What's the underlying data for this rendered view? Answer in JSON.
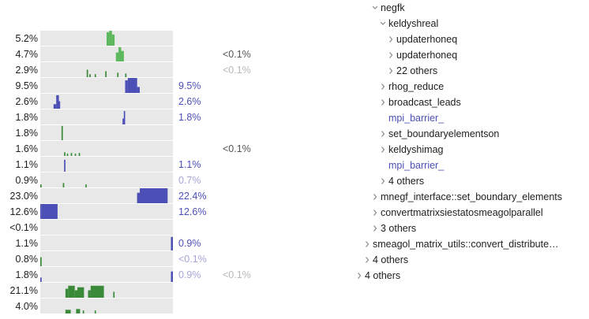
{
  "colors": {
    "green": "#5cb85c",
    "dark_green": "#3a8a3a",
    "blue": "#4b4fb6",
    "track": "#e8e8e8"
  },
  "rows": [
    {
      "pct": "5.2%",
      "self": "",
      "self_style": "",
      "other": "",
      "other_style": "",
      "bar_color": "green",
      "spikes": [
        [
          0.5,
          0.52,
          0.9
        ],
        [
          0.52,
          0.54,
          1.0
        ],
        [
          0.54,
          0.56,
          0.75
        ]
      ]
    },
    {
      "pct": "4.7%",
      "self": "",
      "self_style": "",
      "other": "<0.1%",
      "other_style": "",
      "bar_color": "green",
      "spikes": [
        [
          0.57,
          0.59,
          0.6
        ],
        [
          0.59,
          0.61,
          0.95
        ],
        [
          0.61,
          0.63,
          0.7
        ]
      ]
    },
    {
      "pct": "2.9%",
      "self": "",
      "self_style": "",
      "other": "<0.1%",
      "other_style": "faint",
      "bar_color": "dark_green",
      "spikes": [
        [
          0.35,
          0.36,
          0.5
        ],
        [
          0.37,
          0.38,
          0.2
        ],
        [
          0.41,
          0.42,
          0.2
        ],
        [
          0.49,
          0.5,
          0.4
        ],
        [
          0.58,
          0.59,
          0.3
        ],
        [
          0.64,
          0.65,
          0.25
        ]
      ]
    },
    {
      "pct": "9.5%",
      "self": "9.5%",
      "self_style": "",
      "other": "",
      "other_style": "",
      "bar_color": "blue",
      "spikes": [
        [
          0.64,
          0.66,
          0.85
        ],
        [
          0.66,
          0.73,
          1.0
        ],
        [
          0.73,
          0.75,
          0.4
        ]
      ]
    },
    {
      "pct": "2.6%",
      "self": "2.6%",
      "self_style": "",
      "other": "",
      "other_style": "",
      "bar_color": "blue",
      "spikes": [
        [
          0.1,
          0.12,
          0.3
        ],
        [
          0.12,
          0.14,
          0.9
        ],
        [
          0.14,
          0.15,
          0.5
        ]
      ]
    },
    {
      "pct": "1.8%",
      "self": "1.8%",
      "self_style": "",
      "other": "",
      "other_style": "",
      "bar_color": "blue",
      "spikes": [
        [
          0.62,
          0.63,
          0.4
        ],
        [
          0.63,
          0.64,
          0.9
        ]
      ]
    },
    {
      "pct": "1.8%",
      "self": "",
      "self_style": "",
      "other": "",
      "other_style": "",
      "bar_color": "dark_green",
      "spikes": [
        [
          0.16,
          0.17,
          0.95
        ]
      ]
    },
    {
      "pct": "1.6%",
      "self": "",
      "self_style": "",
      "other": "<0.1%",
      "other_style": "",
      "bar_color": "dark_green",
      "spikes": [
        [
          0.18,
          0.19,
          0.25
        ],
        [
          0.2,
          0.21,
          0.15
        ],
        [
          0.23,
          0.24,
          0.2
        ],
        [
          0.26,
          0.27,
          0.15
        ],
        [
          0.29,
          0.3,
          0.2
        ]
      ]
    },
    {
      "pct": "1.1%",
      "self": "1.1%",
      "self_style": "",
      "other": "",
      "other_style": "",
      "bar_color": "blue",
      "spikes": [
        [
          0.18,
          0.19,
          0.8
        ]
      ]
    },
    {
      "pct": "0.9%",
      "self": "0.7%",
      "self_style": "faint",
      "other": "",
      "other_style": "",
      "bar_color": "dark_green",
      "spikes": [
        [
          0.0,
          0.01,
          0.2
        ],
        [
          0.17,
          0.18,
          0.3
        ],
        [
          0.34,
          0.35,
          0.2
        ]
      ]
    },
    {
      "pct": "23.0%",
      "self": "22.4%",
      "self_style": "",
      "other": "",
      "other_style": "",
      "bar_color": "blue",
      "spikes": [
        [
          0.73,
          0.75,
          0.7
        ],
        [
          0.75,
          0.96,
          1.0
        ]
      ]
    },
    {
      "pct": "12.6%",
      "self": "12.6%",
      "self_style": "",
      "other": "",
      "other_style": "",
      "bar_color": "blue",
      "spikes": [
        [
          0.0,
          0.01,
          1.0
        ],
        [
          0.01,
          0.13,
          1.0
        ]
      ]
    },
    {
      "pct": "<0.1%",
      "self": "",
      "self_style": "",
      "other": "",
      "other_style": "",
      "bar_color": "green",
      "spikes": []
    },
    {
      "pct": "1.1%",
      "self": "0.9%",
      "self_style": "",
      "other": "",
      "other_style": "",
      "bar_color": "blue",
      "spikes": [
        [
          0.985,
          1.0,
          0.9
        ]
      ]
    },
    {
      "pct": "0.8%",
      "self": "<0.1%",
      "self_style": "faint",
      "other": "",
      "other_style": "",
      "bar_color": "dark_green",
      "spikes": [
        [
          0.0,
          0.01,
          0.6
        ]
      ]
    },
    {
      "pct": "1.8%",
      "self": "0.9%",
      "self_style": "faint",
      "other": "<0.1%",
      "other_style": "faint",
      "bar_color": "blue",
      "spikes": [
        [
          0.0,
          0.01,
          0.3
        ],
        [
          0.985,
          1.0,
          0.7
        ]
      ]
    },
    {
      "pct": "21.1%",
      "self": "",
      "self_style": "",
      "other": "",
      "other_style": "",
      "bar_color": "dark_green",
      "spikes": [
        [
          0.19,
          0.21,
          0.6
        ],
        [
          0.21,
          0.26,
          0.8
        ],
        [
          0.26,
          0.28,
          0.5
        ],
        [
          0.28,
          0.33,
          0.7
        ],
        [
          0.36,
          0.38,
          0.5
        ],
        [
          0.38,
          0.48,
          0.8
        ],
        [
          0.55,
          0.56,
          0.4
        ]
      ]
    },
    {
      "pct": "4.0%",
      "self": "",
      "self_style": "",
      "other": "",
      "other_style": "",
      "bar_color": "dark_green",
      "spikes": [
        [
          0.19,
          0.23,
          0.25
        ],
        [
          0.27,
          0.3,
          0.3
        ],
        [
          0.32,
          0.33,
          0.2
        ],
        [
          0.41,
          0.42,
          0.2
        ]
      ]
    }
  ],
  "tree": [
    {
      "label": "negfk",
      "depth": 3,
      "chevron": "down",
      "style": ""
    },
    {
      "label": "keldyshreal",
      "depth": 4,
      "chevron": "down",
      "style": ""
    },
    {
      "label": "updaterhoneq",
      "depth": 5,
      "chevron": "right",
      "style": ""
    },
    {
      "label": "updaterhoneq",
      "depth": 5,
      "chevron": "right",
      "style": ""
    },
    {
      "label": "22 others",
      "depth": 5,
      "chevron": "right",
      "style": ""
    },
    {
      "label": "rhog_reduce",
      "depth": 4,
      "chevron": "right",
      "style": ""
    },
    {
      "label": "broadcast_leads",
      "depth": 4,
      "chevron": "right",
      "style": ""
    },
    {
      "label": "mpi_barrier_",
      "depth": 4,
      "chevron": "",
      "style": "mpi"
    },
    {
      "label": "set_boundaryelementson",
      "depth": 4,
      "chevron": "right",
      "style": ""
    },
    {
      "label": "keldyshimag",
      "depth": 4,
      "chevron": "right",
      "style": ""
    },
    {
      "label": "mpi_barrier_",
      "depth": 4,
      "chevron": "",
      "style": "mpi"
    },
    {
      "label": "4 others",
      "depth": 4,
      "chevron": "right",
      "style": ""
    },
    {
      "label": "mnegf_interface::set_boundary_elements",
      "depth": 3,
      "chevron": "right",
      "style": ""
    },
    {
      "label": "convertmatrixsiestatosmeagolparallel",
      "depth": 3,
      "chevron": "right",
      "style": ""
    },
    {
      "label": "3 others",
      "depth": 3,
      "chevron": "right",
      "style": ""
    },
    {
      "label": "smeagol_matrix_utils::convert_distribute…",
      "depth": 2,
      "chevron": "right",
      "style": ""
    },
    {
      "label": "4 others",
      "depth": 2,
      "chevron": "right",
      "style": ""
    },
    {
      "label": "4 others",
      "depth": 1,
      "chevron": "right",
      "style": ""
    }
  ]
}
